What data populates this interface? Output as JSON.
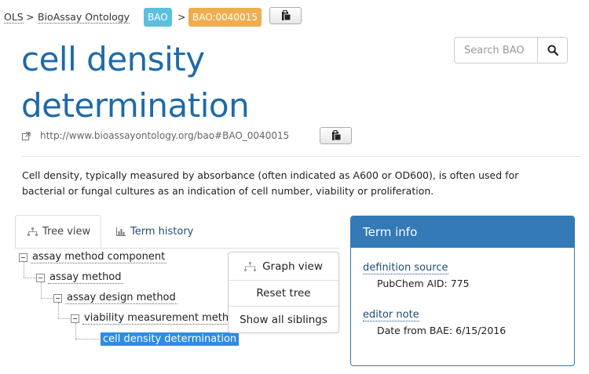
{
  "breadcrumb": {
    "ols": "OLS",
    "sep1": ">",
    "ontology": "BioAssay Ontology",
    "ontology_badge": "BAO",
    "sep2": ">",
    "term_badge": "BAO:0040015"
  },
  "colors": {
    "ontology_badge": "#5bc0de",
    "term_badge": "#f0ad4e",
    "title": "#1f6aa8",
    "panel_accent": "#337ab7",
    "selected_node": "#2d8ce4"
  },
  "title": {
    "line1": "cell density",
    "line2": "determination"
  },
  "search": {
    "placeholder": "Search BAO",
    "icon": "search-icon"
  },
  "iri": "http://www.bioassayontology.org/bao#BAO_0040015",
  "description": {
    "line1": "Cell density, typically measured by absorbance (often indicated as A600 or OD600), is often used for",
    "line2": "bacterial or fungal cultures as an indication of cell number, viability or proliferation."
  },
  "tabs": [
    {
      "label": "Tree view",
      "icon": "sitemap-icon",
      "active": true
    },
    {
      "label": "Term history",
      "icon": "bar-chart-icon",
      "active": false
    }
  ],
  "tree": [
    {
      "label": "assay method component"
    },
    {
      "label": "assay method"
    },
    {
      "label": "assay design method"
    },
    {
      "label": "viability measurement meth"
    },
    {
      "label": "cell density determination",
      "selected": true
    }
  ],
  "tree_menu": {
    "graph_view": "Graph view",
    "reset_tree": "Reset tree",
    "show_siblings": "Show all siblings"
  },
  "term_info": {
    "heading": "Term info",
    "entries": [
      {
        "key": "definition source",
        "value": "PubChem AID: 775"
      },
      {
        "key": "editor note",
        "value": "Date from BAE: 6/15/2016"
      }
    ]
  }
}
